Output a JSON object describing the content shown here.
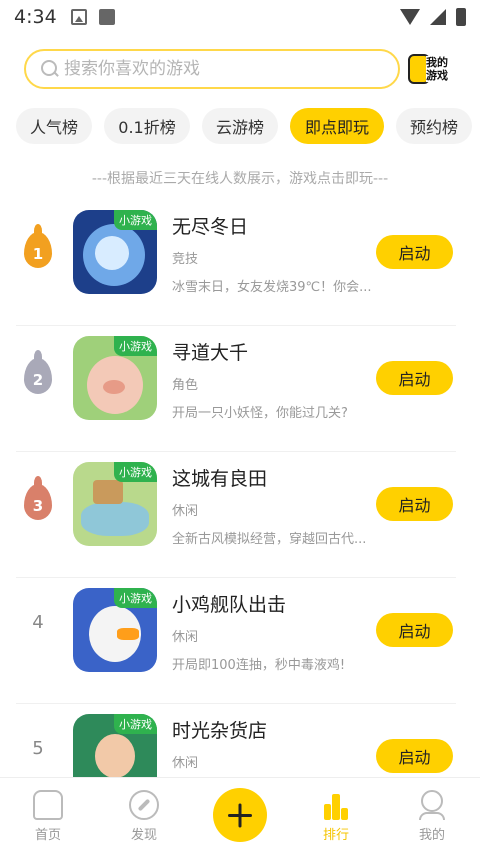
{
  "status_bar": {
    "time": "4:34"
  },
  "search": {
    "placeholder": "搜索你喜欢的游戏",
    "my_games_label": "我的游戏"
  },
  "tabs": [
    {
      "label": "人气榜",
      "active": false
    },
    {
      "label": "0.1折榜",
      "active": false
    },
    {
      "label": "云游榜",
      "active": false
    },
    {
      "label": "即点即玩",
      "active": true
    },
    {
      "label": "预约榜",
      "active": false
    }
  ],
  "hint": "---根据最近三天在线人数展示，游戏点击即玩---",
  "badge_label": "小游戏",
  "launch_label": "启动",
  "games": [
    {
      "rank": "1",
      "name": "无尽冬日",
      "category": "竞技",
      "desc": "冰雪末日，女友发烧39℃！你会...",
      "rank_color": "#f2a020"
    },
    {
      "rank": "2",
      "name": "寻道大千",
      "category": "角色",
      "desc": "开局一只小妖怪，你能过几关?",
      "rank_color": "#a9a9b8"
    },
    {
      "rank": "3",
      "name": "这城有良田",
      "category": "休闲",
      "desc": "全新古风模拟经营，穿越回古代...",
      "rank_color": "#d9806a"
    },
    {
      "rank": "4",
      "name": "小鸡舰队出击",
      "category": "休闲",
      "desc": "开局即100连抽，秒中毒液鸡!"
    },
    {
      "rank": "5",
      "name": "时光杂货店",
      "category": "休闲",
      "desc": ""
    }
  ],
  "nav": [
    {
      "label": "首页",
      "icon": "home-icon"
    },
    {
      "label": "发现",
      "icon": "compass-icon"
    },
    {
      "label": "",
      "icon": "plus-icon"
    },
    {
      "label": "排行",
      "icon": "ranking-icon"
    },
    {
      "label": "我的",
      "icon": "profile-icon"
    }
  ],
  "colors": {
    "accent": "#ffd000",
    "badge": "#2fb24e"
  }
}
